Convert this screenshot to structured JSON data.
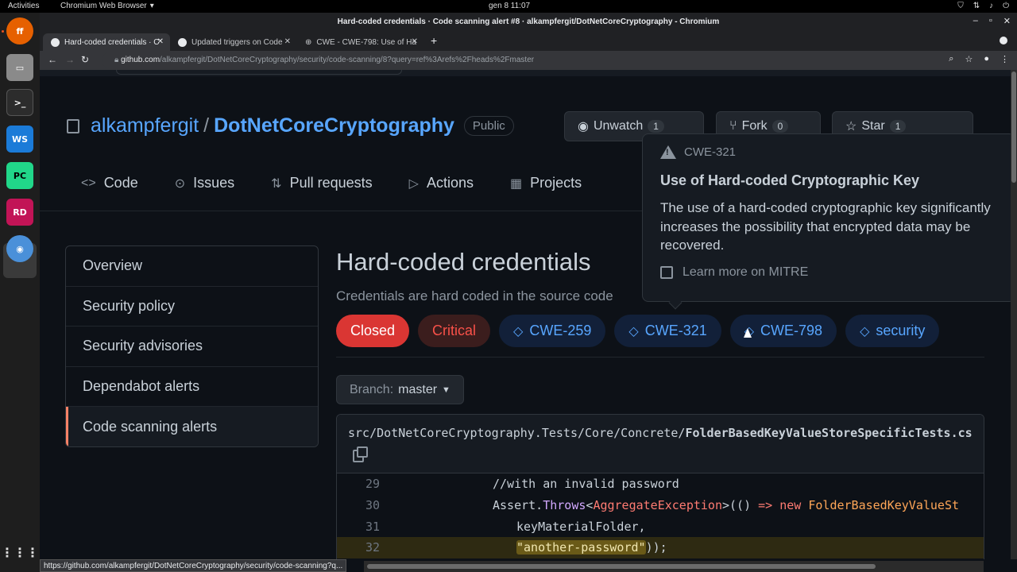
{
  "os": {
    "activities": "Activities",
    "app_name": "Chromium Web Browser",
    "clock": "gen 8  11:07"
  },
  "browser": {
    "window_title": "Hard-coded credentials · Code scanning alert #8 · alkampfergit/DotNetCoreCryptography - Chromium",
    "tabs": [
      {
        "label": "Hard-coded credentials · C",
        "active": true
      },
      {
        "label": "Updated triggers on Code",
        "active": false
      },
      {
        "label": "CWE - CWE-798: Use of Ha",
        "active": false
      }
    ],
    "url_host": "github.com",
    "url_path": "/alkampfergit/DotNetCoreCryptography/security/code-scanning/8?query=ref%3Arefs%2Fheads%2Fmaster",
    "status_url": "https://github.com/alkampfergit/DotNetCoreCryptography/security/code-scanning?q..."
  },
  "repo": {
    "owner": "alkampfergit",
    "separator": "/",
    "name": "DotNetCoreCryptography",
    "visibility": "Public",
    "unwatch_label": "Unwatch",
    "unwatch_count": "1",
    "fork_label": "Fork",
    "fork_count": "0",
    "star_label": "Star",
    "star_count": "1"
  },
  "nav": [
    {
      "label": "Code",
      "icon": "code-icon"
    },
    {
      "label": "Issues",
      "icon": "issue-icon"
    },
    {
      "label": "Pull requests",
      "icon": "pull-request-icon"
    },
    {
      "label": "Actions",
      "icon": "play-icon"
    },
    {
      "label": "Projects",
      "icon": "table-icon"
    }
  ],
  "sidebar": [
    {
      "label": "Overview"
    },
    {
      "label": "Security policy"
    },
    {
      "label": "Security advisories"
    },
    {
      "label": "Dependabot alerts"
    },
    {
      "label": "Code scanning alerts",
      "selected": true
    }
  ],
  "alert": {
    "title": "Hard-coded credentials",
    "description": "Credentials are hard coded in the source code",
    "labels": {
      "status": "Closed",
      "severity": "Critical",
      "tags": [
        "CWE-259",
        "CWE-321",
        "CWE-798",
        "security"
      ]
    },
    "branch_prefix": "Branch:",
    "branch_value": "master"
  },
  "code": {
    "file_dir": "src/DotNetCoreCryptography.Tests/Core/Concrete/",
    "file_name": "FolderBasedKeyValueStoreSpecificTests.cs",
    "lines": [
      {
        "num": "29",
        "text": "//with an invalid password"
      },
      {
        "num": "30",
        "p1": "Assert.",
        "p2": "Throws",
        "p3": "<",
        "p4": "AggregateException",
        "p5": ">(() ",
        "p6": "=>",
        "p7": " ",
        "p8": "new",
        "p9": " ",
        "p10": "FolderBasedKeyValueSt"
      },
      {
        "num": "31",
        "text": "keyMaterialFolder,"
      },
      {
        "num": "32",
        "str": "\"another-password\"",
        "tail": "));"
      }
    ]
  },
  "tooltip": {
    "cwe": "CWE-321",
    "title": "Use of Hard-coded Cryptographic Key",
    "body": "The use of a hard-coded cryptographic key significantly increases the possibility that encrypted data may be recovered.",
    "link": "Learn more on MITRE"
  },
  "colors": {
    "background": "#0d1117",
    "link": "#58a6ff",
    "closed": "#da3633",
    "critical": "#f85149",
    "selected_accent": "#f78166"
  }
}
